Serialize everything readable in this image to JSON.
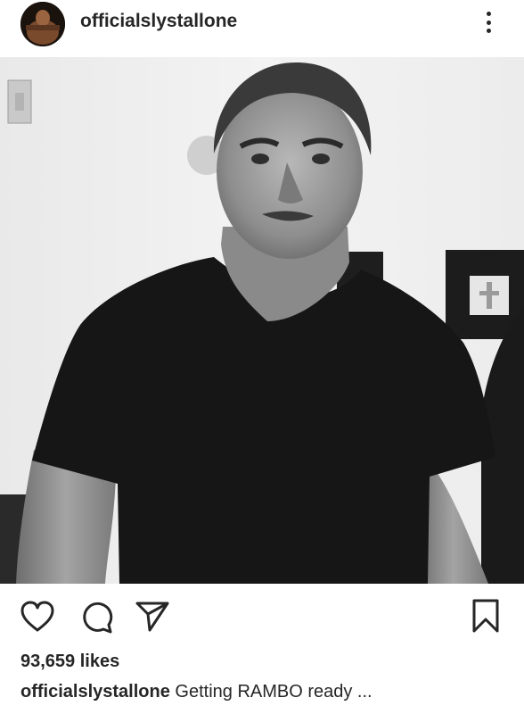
{
  "post": {
    "username": "officialslystallone",
    "likes": "93,659 likes",
    "caption_user": "officialslystallone",
    "caption_text": "Getting RAMBO ready ..."
  },
  "icons": {
    "avatar": "profile-avatar",
    "more": "more-options-icon",
    "like": "heart-icon",
    "comment": "comment-icon",
    "share": "paper-plane-icon",
    "save": "bookmark-icon"
  },
  "colors": {
    "text": "#262626",
    "background": "#ffffff"
  }
}
